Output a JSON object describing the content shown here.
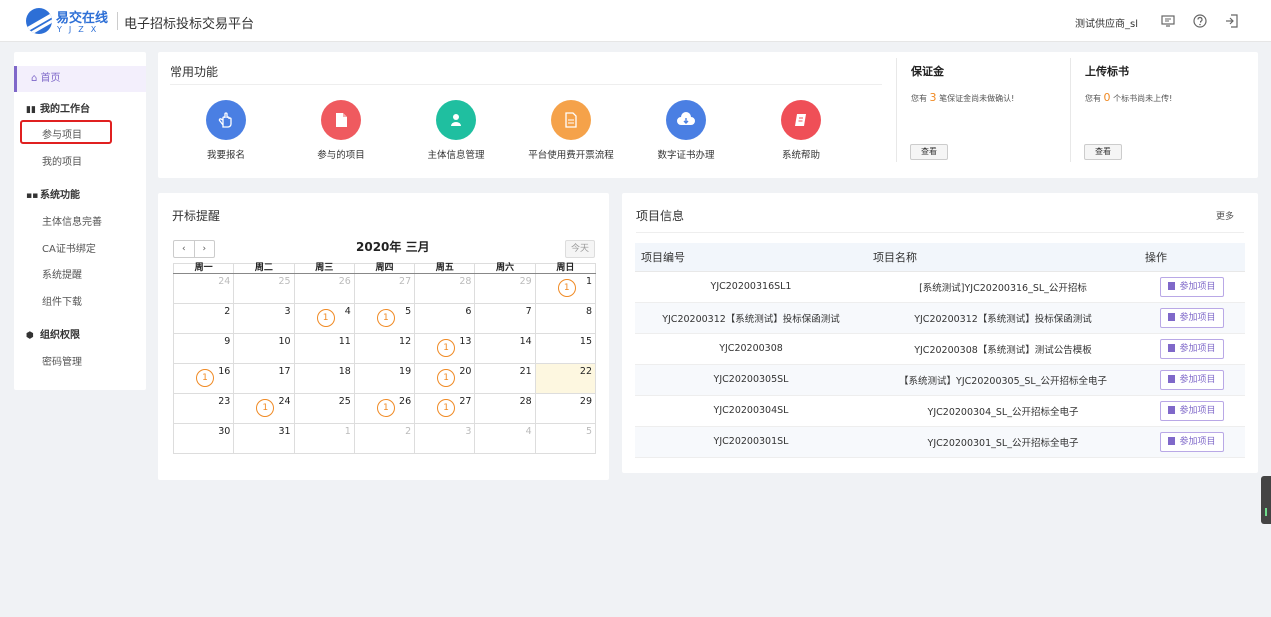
{
  "header": {
    "brand_cn": "易交在线",
    "brand_en": "YJZX",
    "platform_title": "电子招标投标交易平台",
    "user_name": "测试供应商_sl",
    "icons": [
      "monitor-icon",
      "help-icon",
      "logout-icon"
    ]
  },
  "sidebar": {
    "home": "首页",
    "groups": [
      {
        "label": "我的工作台",
        "items": [
          "参与项目",
          "我的项目"
        ]
      },
      {
        "label": "系统功能",
        "items": [
          "主体信息完善",
          "CA证书绑定",
          "系统提醒",
          "组件下载"
        ]
      },
      {
        "label": "组织权限",
        "items": [
          "密码管理"
        ]
      }
    ]
  },
  "common": {
    "title": "常用功能",
    "items": [
      {
        "label": "我要报名",
        "color": "#4a7fe3",
        "icon": "hand-icon"
      },
      {
        "label": "参与的项目",
        "color": "#ef5a5f",
        "icon": "file-icon"
      },
      {
        "label": "主体信息管理",
        "color": "#1fbfa0",
        "icon": "user-icon"
      },
      {
        "label": "平台使用费开票流程",
        "color": "#f5a24a",
        "icon": "document-icon"
      },
      {
        "label": "数字证书办理",
        "color": "#4a7fe3",
        "icon": "cloud-download-icon"
      },
      {
        "label": "系统帮助",
        "color": "#ef4f57",
        "icon": "book-icon"
      }
    ]
  },
  "deposit": {
    "title": "保证金",
    "note_prefix": "您有",
    "count": "3",
    "note_suffix": "笔保证金尚未做确认!",
    "button": "查看"
  },
  "upload": {
    "title": "上传标书",
    "note_prefix": "您有",
    "count": "0",
    "note_suffix": "个标书尚未上传!",
    "button": "查看"
  },
  "calendar": {
    "section_title": "开标提醒",
    "month_title": "2020年 三月",
    "prev": "‹",
    "next": "›",
    "today_btn": "今天",
    "weekdays": [
      "周一",
      "周二",
      "周三",
      "周四",
      "周五",
      "周六",
      "周日"
    ],
    "weeks": [
      [
        {
          "d": "24",
          "o": true
        },
        {
          "d": "25",
          "o": true
        },
        {
          "d": "26",
          "o": true
        },
        {
          "d": "27",
          "o": true
        },
        {
          "d": "28",
          "o": true
        },
        {
          "d": "29",
          "o": true
        },
        {
          "d": "1",
          "b": "1"
        }
      ],
      [
        {
          "d": "2"
        },
        {
          "d": "3"
        },
        {
          "d": "4",
          "b": "1"
        },
        {
          "d": "5",
          "b": "1"
        },
        {
          "d": "6"
        },
        {
          "d": "7"
        },
        {
          "d": "8"
        }
      ],
      [
        {
          "d": "9"
        },
        {
          "d": "10"
        },
        {
          "d": "11"
        },
        {
          "d": "12"
        },
        {
          "d": "13",
          "b": "1"
        },
        {
          "d": "14"
        },
        {
          "d": "15"
        }
      ],
      [
        {
          "d": "16",
          "b": "1"
        },
        {
          "d": "17"
        },
        {
          "d": "18"
        },
        {
          "d": "19"
        },
        {
          "d": "20",
          "b": "1"
        },
        {
          "d": "21"
        },
        {
          "d": "22",
          "t": true
        }
      ],
      [
        {
          "d": "23"
        },
        {
          "d": "24",
          "b": "1"
        },
        {
          "d": "25"
        },
        {
          "d": "26",
          "b": "1"
        },
        {
          "d": "27",
          "b": "1"
        },
        {
          "d": "28"
        },
        {
          "d": "29"
        }
      ],
      [
        {
          "d": "30"
        },
        {
          "d": "31"
        },
        {
          "d": "1",
          "o": true
        },
        {
          "d": "2",
          "o": true
        },
        {
          "d": "3",
          "o": true
        },
        {
          "d": "4",
          "o": true
        },
        {
          "d": "5",
          "o": true
        }
      ]
    ]
  },
  "projects": {
    "title": "项目信息",
    "more": "更多",
    "columns": [
      "项目编号",
      "项目名称",
      "操作"
    ],
    "join_label": "参加项目",
    "rows": [
      {
        "code": "YJC20200316SL1",
        "name": "[系统测试]YJC20200316_SL_公开招标"
      },
      {
        "code": "YJC20200312【系统测试】投标保函测试",
        "name": "YJC20200312【系统测试】投标保函测试"
      },
      {
        "code": "YJC20200308",
        "name": "YJC20200308【系统测试】测试公告模板"
      },
      {
        "code": "YJC20200305SL",
        "name": "【系统测试】YJC20200305_SL_公开招标全电子"
      },
      {
        "code": "YJC20200304SL",
        "name": "YJC20200304_SL_公开招标全电子"
      },
      {
        "code": "YJC20200301SL",
        "name": "YJC20200301_SL_公开招标全电子"
      }
    ]
  }
}
